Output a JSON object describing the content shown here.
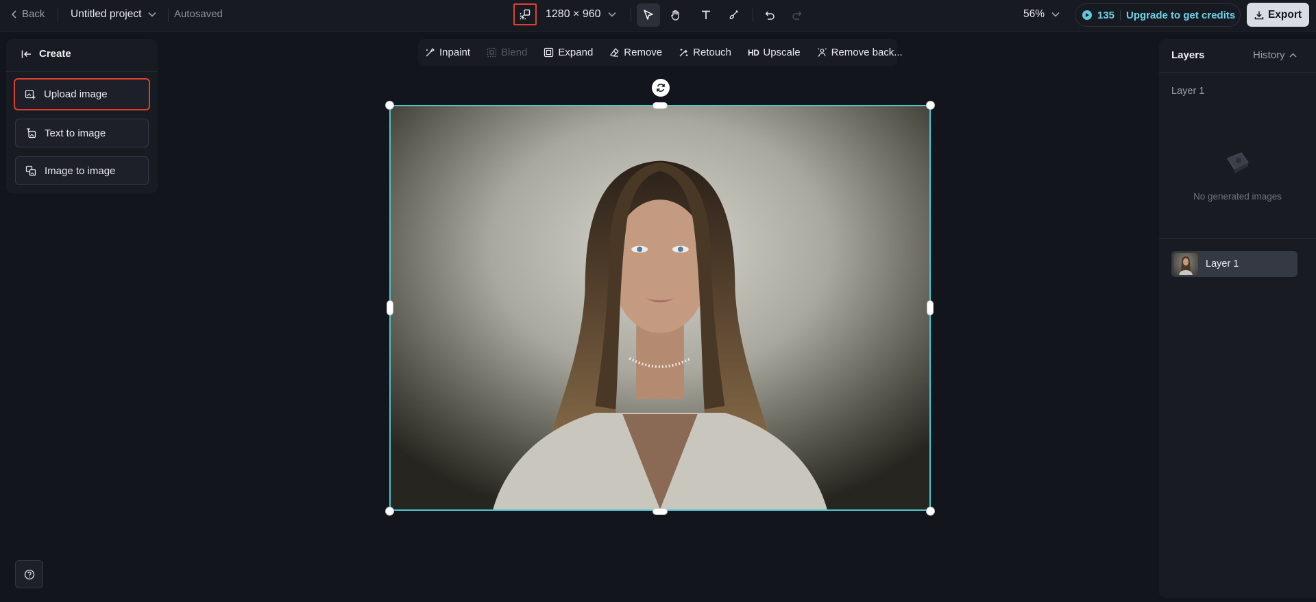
{
  "topbar": {
    "back_label": "Back",
    "project_name": "Untitled project",
    "autosave_status": "Autosaved",
    "canvas_size": "1280 × 960",
    "zoom": "56%",
    "credits": "135",
    "upgrade_label": "Upgrade to get credits",
    "export_label": "Export",
    "tools": [
      "select-tool",
      "hand-tool",
      "text-tool",
      "brush-tool",
      "undo",
      "redo"
    ]
  },
  "left_panel": {
    "header": "Create",
    "buttons": [
      {
        "label": "Upload image",
        "icon": "upload-image-icon"
      },
      {
        "label": "Text to image",
        "icon": "text-to-image-icon"
      },
      {
        "label": "Image to image",
        "icon": "image-to-image-icon"
      }
    ]
  },
  "edit_toolbar": {
    "items": [
      {
        "label": "Inpaint",
        "enabled": true
      },
      {
        "label": "Blend",
        "enabled": false
      },
      {
        "label": "Expand",
        "enabled": true
      },
      {
        "label": "Remove",
        "enabled": true
      },
      {
        "label": "Retouch",
        "enabled": true
      },
      {
        "label": "Upscale",
        "badge": "HD",
        "enabled": true
      },
      {
        "label": "Remove back...",
        "enabled": true
      }
    ]
  },
  "right_panel": {
    "title": "Layers",
    "history_label": "History",
    "section_label": "Layer 1",
    "empty_text": "No generated images",
    "layers": [
      {
        "name": "Layer 1"
      }
    ]
  },
  "colors": {
    "background": "#12151b",
    "accent": "#4cc6cf",
    "highlight": "#e0412f",
    "credits": "#6fd3e8"
  }
}
